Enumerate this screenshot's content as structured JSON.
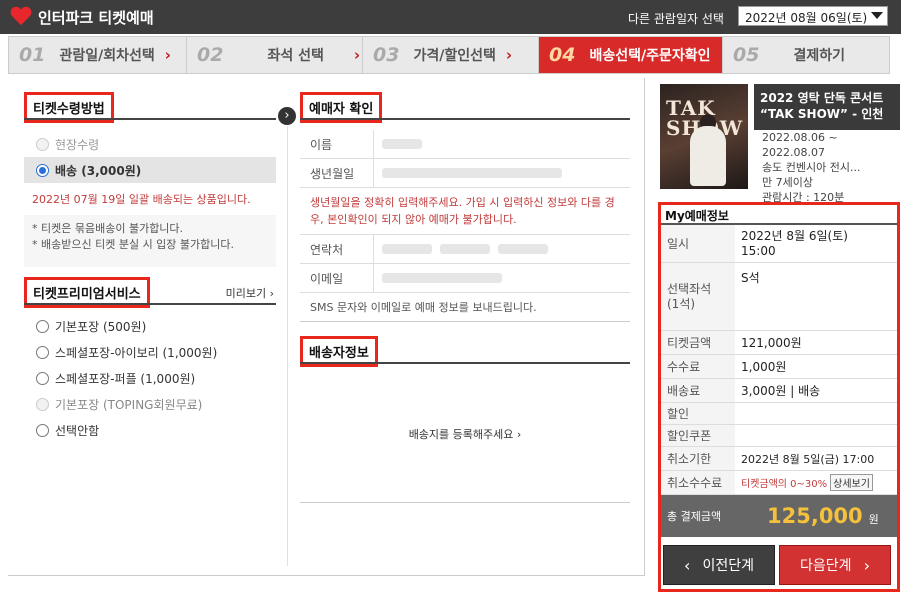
{
  "header": {
    "logo_text": "인터파크 티켓예매",
    "date_label": "다른 관람일자 선택",
    "date_value": "2022년 08월 06일(토)"
  },
  "steps": [
    {
      "num": "01",
      "label": "관람일/회차선택"
    },
    {
      "num": "02",
      "label": "좌석 선택"
    },
    {
      "num": "03",
      "label": "가격/할인선택"
    },
    {
      "num": "04",
      "label": "배송선택/주문자확인"
    },
    {
      "num": "05",
      "label": "결제하기"
    }
  ],
  "left": {
    "delivery_title": "티켓수령방법",
    "opt_onsite": "현장수령",
    "opt_delivery": "배송 (3,000원)",
    "delivery_note": "2022년 07월 19일 일괄 배송되는 상품입니다.",
    "note1": "* 티켓은 묶음배송이 불가합니다.",
    "note2": "* 배송받으신 티켓 분실 시 입장 불가합니다.",
    "premium_title": "티켓프리미엄서비스",
    "preview": "미리보기",
    "premium_opts": [
      "기본포장 (500원)",
      "스페셜포장-아이보리 (1,000원)",
      "스페셜포장-퍼플 (1,000원)",
      "기본포장 (TOPING회원무료)",
      "선택안함"
    ]
  },
  "middle": {
    "booker_title": "예매자 확인",
    "name_label": "이름",
    "birth_label": "생년월일",
    "birth_notice": "생년월일을 정확히 입력해주세요. 가입 시 입력하신 정보와 다를 경우, 본인확인이 되지 않아 예매가 불가합니다.",
    "contact_label": "연락처",
    "email_label": "이메일",
    "sms_note": "SMS 문자와 이메일로 예매 정보를 보내드립니다.",
    "shipping_title": "배송자정보",
    "register_link": "배송지를 등록해주세요"
  },
  "right": {
    "concert_title": "2022 영탁 단독 콘서트 “TAK SHOW” - 인천",
    "dates1": "2022.08.06 ~",
    "dates2": "2022.08.07",
    "venue": "송도 컨벤시아 전시...",
    "age": "만 7세이상",
    "runtime": "관람시간 : 120분",
    "poster_text": "TAK SHOW",
    "my_title": "My예매정보",
    "date_k": "일시",
    "date_v1": "2022년 8월 6일(토)",
    "date_v2": "15:00",
    "seat_k": "선택좌석",
    "seat_k2": "(1석)",
    "seat_v": "S석",
    "ticket_k": "티켓금액",
    "ticket_v": "121,000원",
    "fee_k": "수수료",
    "fee_v": "1,000원",
    "ship_k": "배송료",
    "ship_v": "3,000원 | 배송",
    "discount_k": "할인",
    "coupon_k": "할인쿠폰",
    "cancel_k": "취소기한",
    "cancel_v": "2022년 8월 5일(금) 17:00",
    "cfee_k": "취소수수료",
    "cfee_v": "티켓금액의 0~30%",
    "detail_btn": "상세보기",
    "total_k": "총 결제금액",
    "total_v": "125,000",
    "won": "원",
    "prev_btn": "이전단계",
    "next_btn": "다음단계"
  },
  "colors": {
    "accent": "#d92a2a",
    "highlight": "#e8271d",
    "total": "#f5c13c"
  }
}
